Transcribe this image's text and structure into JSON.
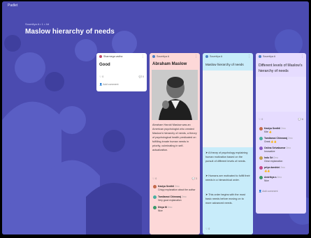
{
  "app": {
    "brand": "Padlet"
  },
  "header": {
    "breadcrumb": "Soumitya A  •  1  •  4d",
    "title": "Maslow hierarchy of needs"
  },
  "colors": {
    "background": "#4b4bb0",
    "card_white": "#ffffff",
    "card_pink": "#fdd8d8",
    "card_blue": "#c8ecfa",
    "card_purple": "#e6dcff"
  },
  "posts": [
    {
      "author": "Sharmega vadha",
      "title": "Good",
      "likes": "0",
      "comments": "0",
      "add_comment": "Add comment"
    },
    {
      "author": "Soumitya A",
      "title": "Abraham Maslow",
      "image": "portrait-photo",
      "body": "Abraham Harold Maslow was an American psychologist who created Maslow's hierarchy of needs, a theory of psychological health predicated on fulfilling innate human needs in priority, culminating in self-actualization.",
      "likes": "0",
      "comments": "3",
      "comment_list": [
        {
          "name": "Kaviya Senthil",
          "time": "2mo",
          "text": "Crispy explanation about the author"
        },
        {
          "name": "Tamilarasi Chinnaraj",
          "time": "2mo",
          "text": "Very good explanation"
        },
        {
          "name": "Divya M",
          "time": "2mo",
          "text": "Nice"
        }
      ]
    },
    {
      "author": "Soumitya A",
      "title": "Maslow hierarchy of needs",
      "body_lines": [
        "➤ A theory of psychology explaining human motivation based on the pursuit of different levels of needs.",
        "➤ Humans are motivated to fulfill their needs in a hierarchical order.",
        "➤ This order begins with the most basic needs before moving on to more advanced needs."
      ],
      "likes": "0"
    },
    {
      "author": "Soumitya A",
      "title": "Different levels of Maslow's hierarchy of needs",
      "likes": "0",
      "comments": "6",
      "comment_list": [
        {
          "name": "Kaviya Senthil",
          "time": "2mo",
          "text": "Kite 👍"
        },
        {
          "name": "Tamilarasi Chinnaraj",
          "time": "2mo",
          "text": "Great 👍👍"
        },
        {
          "name": "Ostina Selvakumar",
          "time": "2mo",
          "text": "Innovative"
        },
        {
          "name": "Indu Sri",
          "time": "2mo",
          "text": "Clear explanation"
        },
        {
          "name": "priya darshini",
          "time": "2mo",
          "text": "👍👍"
        },
        {
          "name": "Amirthya s",
          "time": "2mo",
          "text": "Nice"
        }
      ],
      "add_comment": "Add comment"
    }
  ]
}
